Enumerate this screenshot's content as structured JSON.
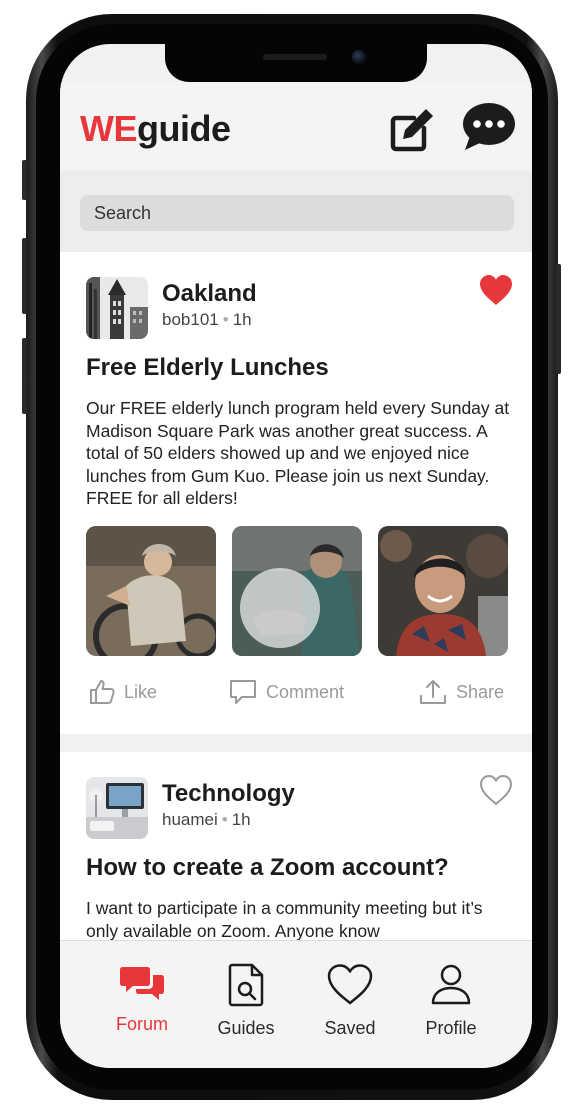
{
  "app": {
    "logo_we": "WE",
    "logo_rest": "guide",
    "icons": {
      "compose": "compose-icon",
      "chat": "chat-bubble-icon"
    }
  },
  "search": {
    "placeholder": "Search"
  },
  "posts": [
    {
      "category": "Oakland",
      "author": "bob101",
      "time": "1h",
      "liked": true,
      "title": "Free Elderly Lunches",
      "body": "Our FREE elderly lunch program held every Sunday at Madison Square Park was another great success. A total of 50 elders showed up and we enjoyed nice lunches from Gum Kuo. Please join us next Sunday. FREE for all elders!",
      "actions": {
        "like": "Like",
        "comment": "Comment",
        "share": "Share"
      }
    },
    {
      "category": "Technology",
      "author": "huamei",
      "time": "1h",
      "liked": false,
      "title": "How to create a Zoom account?",
      "body": "I want to participate in a community meeting but it’s only available on Zoom. Anyone know"
    }
  ],
  "tabs": [
    {
      "label": "Forum",
      "icon": "forum-icon",
      "active": true
    },
    {
      "label": "Guides",
      "icon": "guide-document-icon",
      "active": false
    },
    {
      "label": "Saved",
      "icon": "heart-icon",
      "active": false
    },
    {
      "label": "Profile",
      "icon": "profile-icon",
      "active": false
    }
  ],
  "colors": {
    "accent": "#e8373b",
    "text": "#1c1c1c",
    "muted": "#9a9a9a"
  }
}
